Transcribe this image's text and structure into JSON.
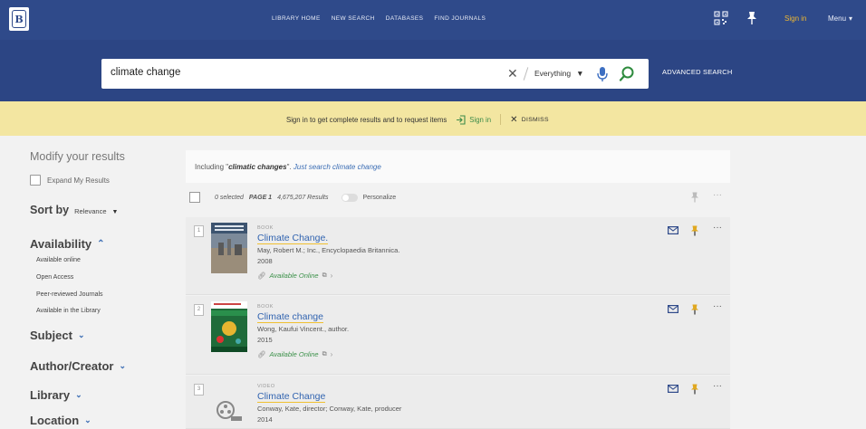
{
  "header": {
    "logo_letter": "B",
    "nav": [
      "LIBRARY HOME",
      "NEW SEARCH",
      "DATABASES",
      "FIND JOURNALS"
    ],
    "sign_in": "Sign in",
    "menu": "Menu"
  },
  "search": {
    "query": "climate change",
    "scope": "Everything",
    "advanced": "ADVANCED SEARCH"
  },
  "banner": {
    "message": "Sign in to get complete results and to request items",
    "sign_in": "Sign in",
    "dismiss": "DISMISS"
  },
  "sidebar": {
    "title": "Modify your results",
    "expand": "Expand My Results",
    "sort_label": "Sort by",
    "sort_value": "Relevance",
    "availability": "Availability",
    "availability_items": [
      "Available online",
      "Open Access",
      "Peer-reviewed Journals",
      "Available in the Library"
    ],
    "facets": [
      "Subject",
      "Author/Creator",
      "Library",
      "Location"
    ]
  },
  "results": {
    "including_prefix": "Including \"",
    "including_term": "climatic changes",
    "including_suffix": "\".",
    "just_search": "Just search",
    "just_search_term": "climate change",
    "selected": "0 selected",
    "page": "PAGE 1",
    "count": "4,675,207 Results",
    "personalize": "Personalize",
    "items": [
      {
        "index": "1",
        "type": "BOOK",
        "title": "Climate Change.",
        "author": "May, Robert M.; Inc., Encyclopaedia Britannica.",
        "year": "2008",
        "availability": "Available Online"
      },
      {
        "index": "2",
        "type": "BOOK",
        "title": "Climate change",
        "author": "Wong, Kaufui Vincent., author.",
        "year": "2015",
        "availability": "Available Online"
      },
      {
        "index": "3",
        "type": "VIDEO",
        "title": "Climate Change",
        "author": "Conway, Kate, director; Conway, Kate, producer",
        "year": "2014"
      }
    ]
  },
  "colors": {
    "topbar": "#2f4a8a",
    "banner": "#f3e6a1",
    "link": "#3264b0",
    "available": "#3a9048",
    "pin": "#e0a820"
  }
}
